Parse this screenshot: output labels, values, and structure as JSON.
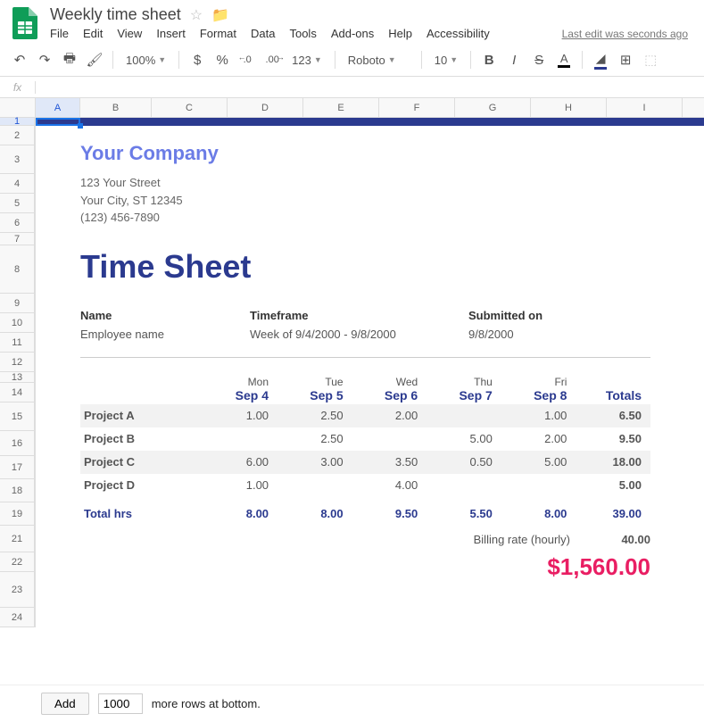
{
  "doc": {
    "title": "Weekly time sheet",
    "last_edit": "Last edit was seconds ago"
  },
  "menu": {
    "file": "File",
    "edit": "Edit",
    "view": "View",
    "insert": "Insert",
    "format": "Format",
    "data": "Data",
    "tools": "Tools",
    "addons": "Add-ons",
    "help": "Help",
    "accessibility": "Accessibility"
  },
  "toolbar": {
    "zoom": "100%",
    "currency": "$",
    "percent": "%",
    "decdec": ".0",
    "incdec": ".00",
    "numfmt": "123",
    "font": "Roboto",
    "size": "10",
    "bold": "B",
    "italic": "I",
    "strike": "S",
    "textcolor": "A"
  },
  "cols": [
    "A",
    "B",
    "C",
    "D",
    "E",
    "F",
    "G",
    "H",
    "I"
  ],
  "rows": [
    "1",
    "2",
    "3",
    "4",
    "5",
    "6",
    "7",
    "8",
    "9",
    "10",
    "11",
    "12",
    "13",
    "14",
    "15",
    "16",
    "17",
    "18",
    "19",
    "21",
    "22",
    "23",
    "24"
  ],
  "content": {
    "company": "Your Company",
    "addr1": "123 Your Street",
    "addr2": "Your City, ST 12345",
    "phone": "(123) 456-7890",
    "title": "Time Sheet",
    "name_label": "Name",
    "name_value": "Employee name",
    "tf_label": "Timeframe",
    "tf_value": "Week of 9/4/2000 - 9/8/2000",
    "sub_label": "Submitted on",
    "sub_value": "9/8/2000",
    "days": [
      "Mon",
      "Tue",
      "Wed",
      "Thu",
      "Fri"
    ],
    "dates": [
      "Sep 4",
      "Sep 5",
      "Sep 6",
      "Sep 7",
      "Sep 8"
    ],
    "totals_label": "Totals",
    "projects": [
      {
        "name": "Project A",
        "vals": [
          "1.00",
          "2.50",
          "2.00",
          "",
          "1.00"
        ],
        "total": "6.50"
      },
      {
        "name": "Project B",
        "vals": [
          "",
          "2.50",
          "",
          "5.00",
          "2.00"
        ],
        "total": "9.50"
      },
      {
        "name": "Project C",
        "vals": [
          "6.00",
          "3.00",
          "3.50",
          "0.50",
          "5.00"
        ],
        "total": "18.00"
      },
      {
        "name": "Project D",
        "vals": [
          "1.00",
          "",
          "4.00",
          "",
          ""
        ],
        "total": "5.00"
      }
    ],
    "totalhrs_label": "Total hrs",
    "totalhrs": [
      "8.00",
      "8.00",
      "9.50",
      "5.50",
      "8.00"
    ],
    "totalhrs_sum": "39.00",
    "billing_label": "Billing rate (hourly)",
    "billing_rate": "40.00",
    "grand_total": "$1,560.00"
  },
  "footer": {
    "add": "Add",
    "rows": "1000",
    "text": "more rows at bottom."
  },
  "chart_data": {
    "type": "table",
    "title": "Time Sheet — hours by project per day",
    "categories": [
      "Mon Sep 4",
      "Tue Sep 5",
      "Wed Sep 6",
      "Thu Sep 7",
      "Fri Sep 8"
    ],
    "series": [
      {
        "name": "Project A",
        "values": [
          1.0,
          2.5,
          2.0,
          null,
          1.0
        ]
      },
      {
        "name": "Project B",
        "values": [
          null,
          2.5,
          null,
          5.0,
          2.0
        ]
      },
      {
        "name": "Project C",
        "values": [
          6.0,
          3.0,
          3.5,
          0.5,
          5.0
        ]
      },
      {
        "name": "Project D",
        "values": [
          1.0,
          null,
          4.0,
          null,
          null
        ]
      }
    ],
    "row_totals": [
      6.5,
      9.5,
      18.0,
      5.0
    ],
    "col_totals": [
      8.0,
      8.0,
      9.5,
      5.5,
      8.0
    ],
    "grand_total_hours": 39.0,
    "billing_rate_hourly": 40.0,
    "billed_amount": 1560.0
  }
}
